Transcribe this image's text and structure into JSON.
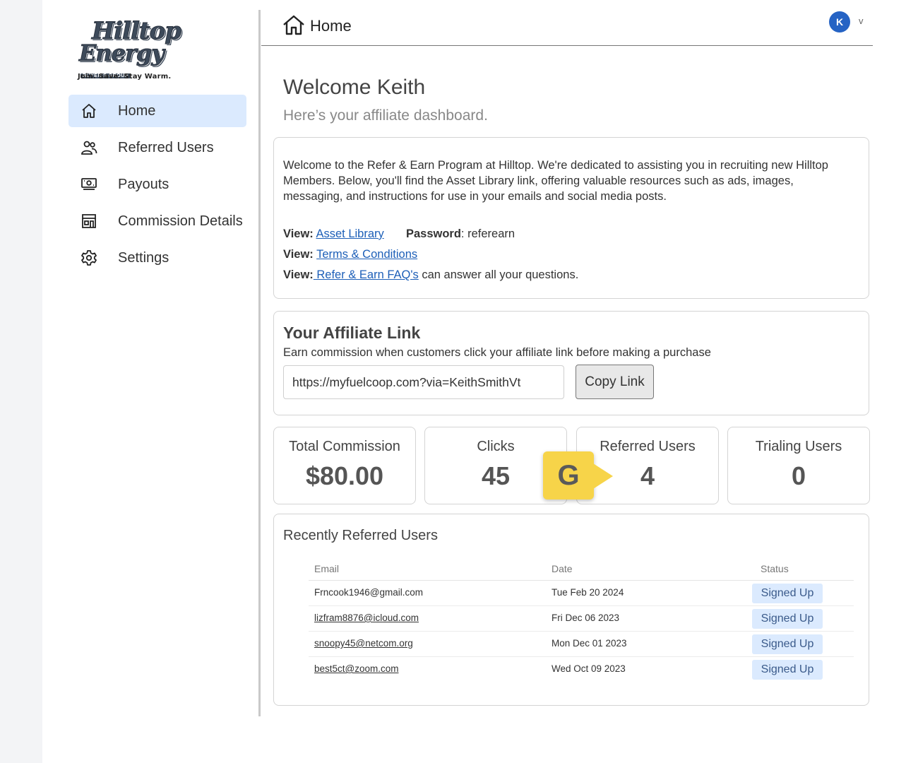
{
  "brand": {
    "logo_line1": "Hilltop",
    "logo_line2": "Energy",
    "logo_sub": "BUYER'S GROUP",
    "tagline": "Join. Save. Stay Warm."
  },
  "sidebar": {
    "items": [
      {
        "label": "Home",
        "icon": "home-icon",
        "active": true
      },
      {
        "label": "Referred Users",
        "icon": "users-icon",
        "active": false
      },
      {
        "label": "Payouts",
        "icon": "money-icon",
        "active": false
      },
      {
        "label": "Commission Details",
        "icon": "store-icon",
        "active": false
      },
      {
        "label": "Settings",
        "icon": "gear-icon",
        "active": false
      }
    ]
  },
  "header": {
    "title": "Home",
    "avatar_initial": "K",
    "avatar_chevron": "v",
    "avatar_color": "#2563c4"
  },
  "welcome": {
    "title": "Welcome Keith",
    "subtitle": "Here’s your affiliate dashboard."
  },
  "intro": {
    "text": "Welcome to the Refer & Earn Program at Hilltop. We're dedicated to assisting you in recruiting new Hilltop Members. Below, you'll find the Asset Library link, offering valuable resources such as ads, images, messaging, and instructions for use in your emails and social media posts.",
    "view_label": "View:",
    "asset_library": "Asset Library",
    "password_label": "Password",
    "password_value": ": referearn",
    "terms": "Terms & Conditions",
    "faq": " Refer & Earn FAQ's",
    "faq_suffix": " can answer all your questions."
  },
  "affiliate": {
    "title": "Your Affiliate Link",
    "description": "Earn commission when customers click your affiliate link before making a purchase",
    "link_value": "https://myfuelcoop.com?via=KeithSmithVt",
    "copy_label": "Copy Link"
  },
  "stats": [
    {
      "label": "Total Commission",
      "value": "$80.00"
    },
    {
      "label": "Clicks",
      "value": "45"
    },
    {
      "label": "Referred Users",
      "value": "4"
    },
    {
      "label": "Trialing Users",
      "value": "0"
    }
  ],
  "annotation": {
    "letter": "G",
    "color": "#f7d449"
  },
  "recent": {
    "title": "Recently Referred Users",
    "headers": {
      "email": "Email",
      "date": "Date",
      "status": "Status"
    },
    "rows": [
      {
        "email": "Frncook1946@gmail.com",
        "date": "Tue Feb 20 2024",
        "status": "Signed Up"
      },
      {
        "email": "lizfram8876@icloud.com",
        "date": "Fri Dec 06 2023",
        "status": "Signed Up"
      },
      {
        "email": "snoopy45@netcom.org",
        "date": "Mon Dec 01 2023",
        "status": "Signed Up"
      },
      {
        "email": "best5ct@zoom.com",
        "date": "Wed Oct 09 2023",
        "status": "Signed Up"
      }
    ]
  }
}
